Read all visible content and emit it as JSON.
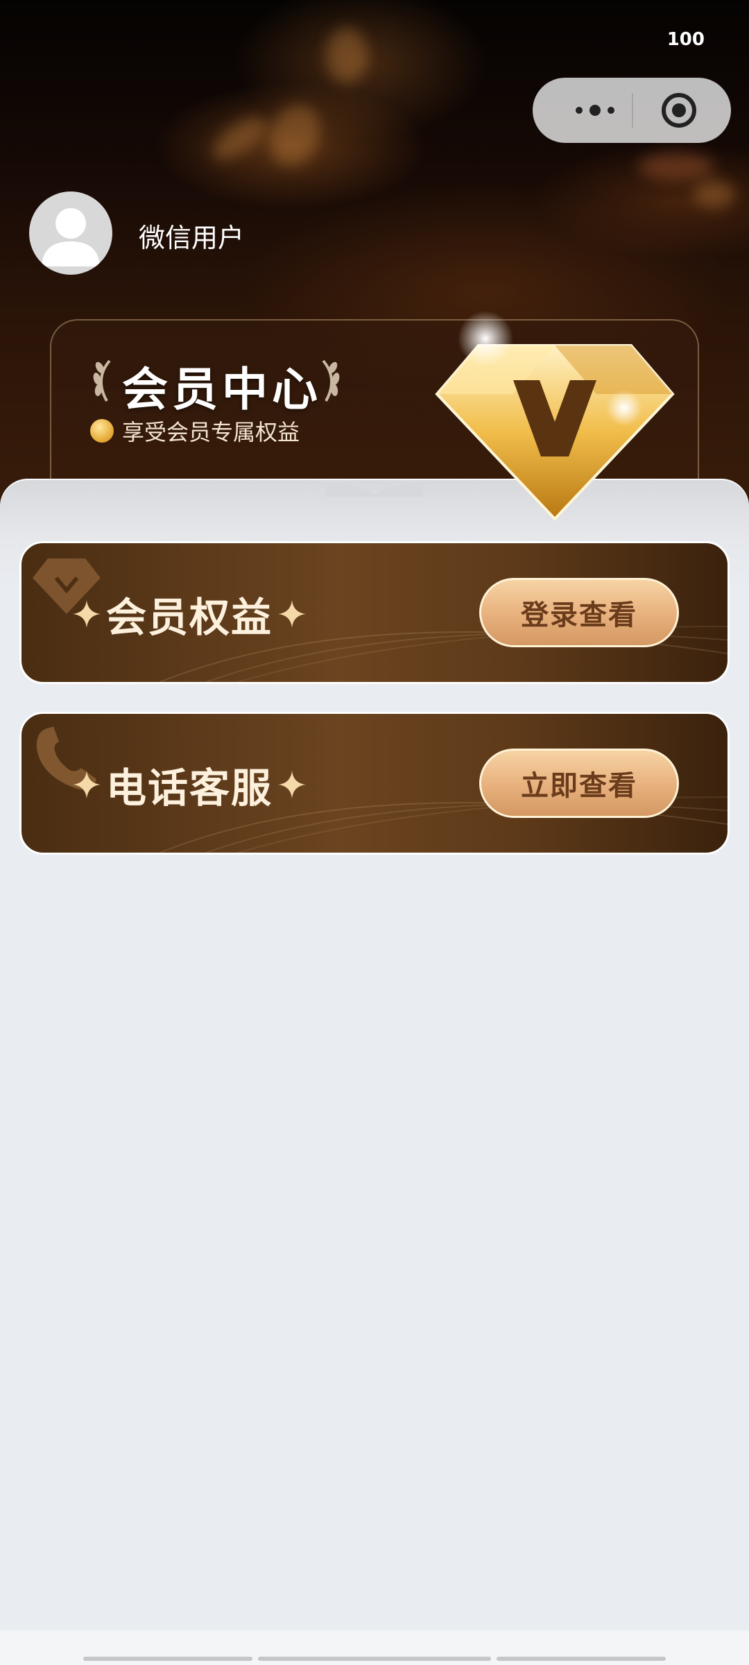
{
  "status_bar": {
    "battery": "100"
  },
  "capsule": {
    "more_icon": "more-dots-icon",
    "close_icon": "target-circle-icon"
  },
  "user": {
    "name": "微信用户",
    "avatar_icon": "default-avatar-icon"
  },
  "vip_card": {
    "title": "会员中心",
    "subtitle": "享受会员专属权益",
    "badge_icon": "diamond-v-icon"
  },
  "features": [
    {
      "label": "会员权益",
      "button": "登录查看",
      "icon": "diamond-badge-icon"
    },
    {
      "label": "电话客服",
      "button": "立即查看",
      "icon": "phone-icon"
    }
  ],
  "colors": {
    "gold_text": "#fdf1de",
    "button_text": "#6a3c1c",
    "page_bg": "#e9ecf1"
  }
}
